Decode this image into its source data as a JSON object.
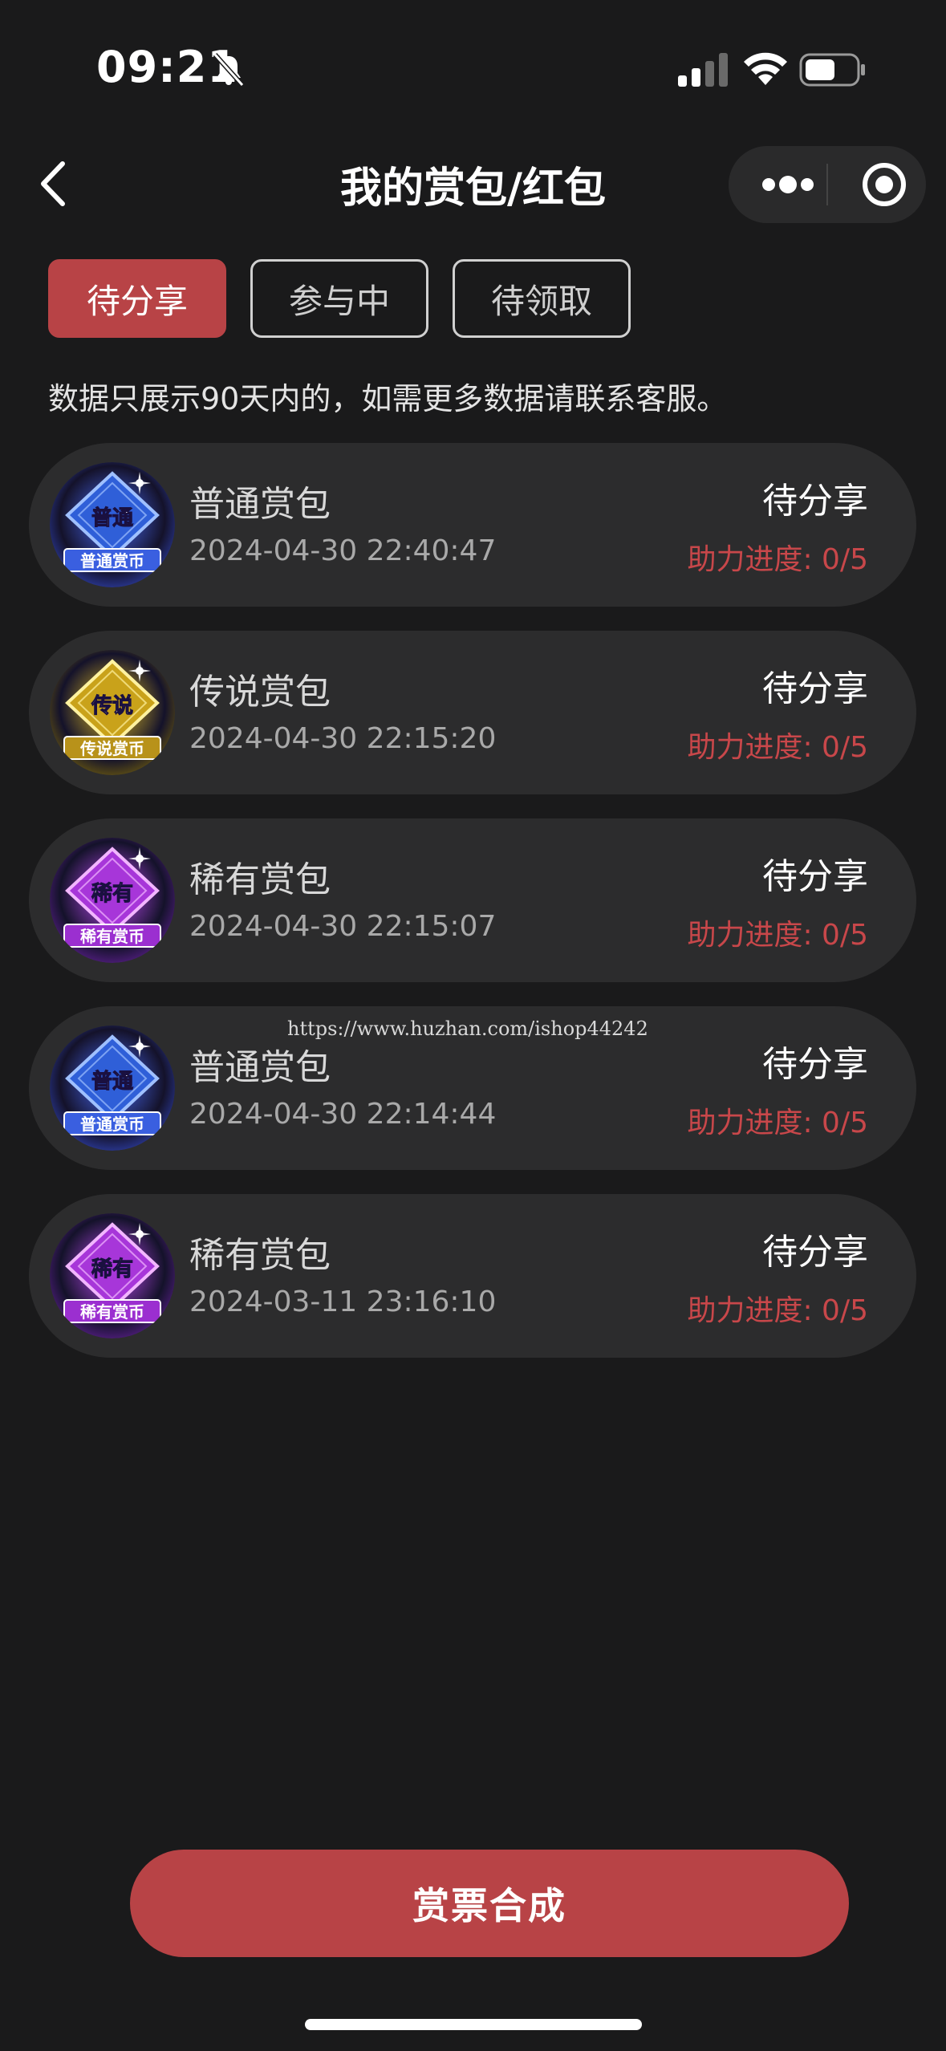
{
  "status_bar": {
    "time": "09:21",
    "battery_icon": "battery-icon",
    "signal_icon": "signal-icon",
    "wifi_icon": "wifi-icon",
    "mute_icon": "bell-slash-icon"
  },
  "nav": {
    "title": "我的赏包/红包",
    "back_icon": "chevron-left-icon",
    "more_icon": "more-dots-icon",
    "close_icon": "target-icon"
  },
  "tabs": [
    {
      "label": "待分享",
      "active": true
    },
    {
      "label": "参与中",
      "active": false
    },
    {
      "label": "待领取",
      "active": false
    }
  ],
  "notice": "数据只展示90天内的，如需更多数据请联系客服。",
  "items": [
    {
      "badge_label": "普通",
      "badge_coin": "普通赏币",
      "badge_theme": "blue",
      "name": "普通赏包",
      "date": "2024-04-30 22:40:47",
      "status": "待分享",
      "progress": "助力进度: 0/5"
    },
    {
      "badge_label": "传说",
      "badge_coin": "传说赏币",
      "badge_theme": "gold",
      "name": "传说赏包",
      "date": "2024-04-30 22:15:20",
      "status": "待分享",
      "progress": "助力进度: 0/5"
    },
    {
      "badge_label": "稀有",
      "badge_coin": "稀有赏币",
      "badge_theme": "purple",
      "name": "稀有赏包",
      "date": "2024-04-30 22:15:07",
      "status": "待分享",
      "progress": "助力进度: 0/5"
    },
    {
      "badge_label": "普通",
      "badge_coin": "普通赏币",
      "badge_theme": "blue",
      "name": "普通赏包",
      "date": "2024-04-30 22:14:44",
      "status": "待分享",
      "progress": "助力进度: 0/5"
    },
    {
      "badge_label": "稀有",
      "badge_coin": "稀有赏币",
      "badge_theme": "purple",
      "name": "稀有赏包",
      "date": "2024-03-11 23:16:10",
      "status": "待分享",
      "progress": "助力进度: 0/5"
    }
  ],
  "watermark": "https://www.huzhan.com/ishop44242",
  "bottom_button": "赏票合成",
  "colors": {
    "accent": "#b84346",
    "background": "#1a1a1b",
    "card": "#2c2c2d",
    "progress": "#c8474a"
  }
}
